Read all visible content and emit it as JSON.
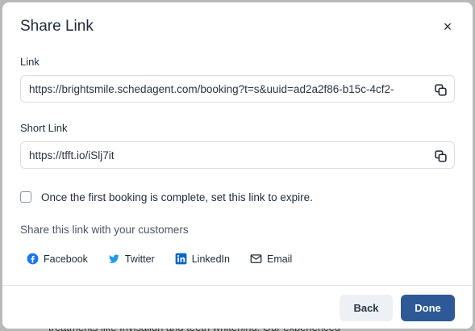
{
  "backdrop": {
    "text": "treatments like Invisalign and teeth whitening. Our experienced"
  },
  "modal": {
    "title": "Share Link",
    "close_icon": "×"
  },
  "link": {
    "label": "Link",
    "value": "https://brightsmile.schedagent.com/booking?t=s&uuid=ad2a2f86-b15c-4cf2-"
  },
  "short_link": {
    "label": "Short Link",
    "value": "https://tfft.io/iSlj7it"
  },
  "expire": {
    "label": "Once the first booking is complete, set this link to expire.",
    "checked": false
  },
  "share": {
    "title": "Share this link with your customers",
    "items": [
      {
        "label": "Facebook",
        "icon": "facebook-icon",
        "color": "#1877f2"
      },
      {
        "label": "Twitter",
        "icon": "twitter-icon",
        "color": "#1d9bf0"
      },
      {
        "label": "LinkedIn",
        "icon": "linkedin-icon",
        "color": "#0a66c2"
      },
      {
        "label": "Email",
        "icon": "email-icon",
        "color": "#1f2937"
      }
    ]
  },
  "footer": {
    "back_label": "Back",
    "done_label": "Done"
  },
  "colors": {
    "primary": "#2d5a96",
    "secondary_button": "#edf0f4",
    "border": "#d9dde3"
  }
}
